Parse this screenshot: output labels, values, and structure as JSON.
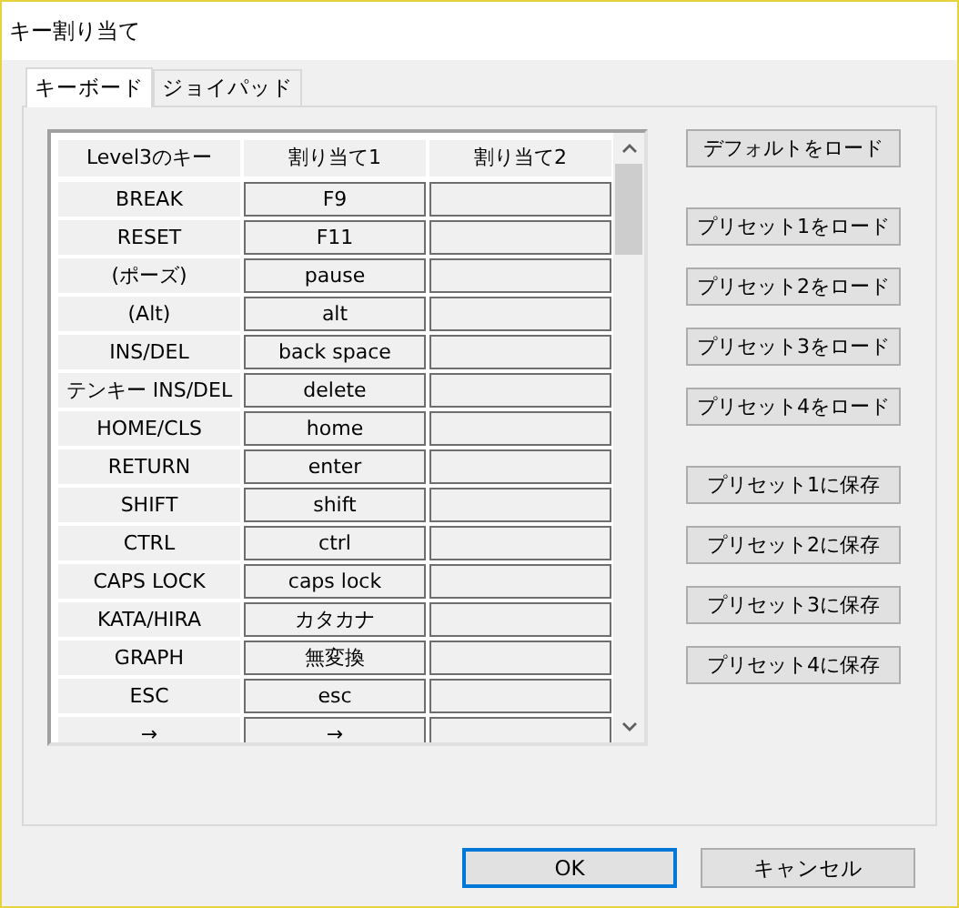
{
  "window": {
    "title": "キー割り当て"
  },
  "tabs": [
    {
      "label": "キーボード",
      "selected": true
    },
    {
      "label": "ジョイパッド",
      "selected": false
    }
  ],
  "table": {
    "columns": [
      "Level3のキー",
      "割り当て1",
      "割り当て2"
    ],
    "rows": [
      {
        "key": "BREAK",
        "assign_1": "F9",
        "assign_2": ""
      },
      {
        "key": "RESET",
        "assign_1": "F11",
        "assign_2": ""
      },
      {
        "key": "(ポーズ)",
        "assign_1": "pause",
        "assign_2": ""
      },
      {
        "key": "(Alt)",
        "assign_1": "alt",
        "assign_2": ""
      },
      {
        "key": "INS/DEL",
        "assign_1": "back space",
        "assign_2": ""
      },
      {
        "key": "テンキー INS/DEL",
        "assign_1": "delete",
        "assign_2": ""
      },
      {
        "key": "HOME/CLS",
        "assign_1": "home",
        "assign_2": ""
      },
      {
        "key": "RETURN",
        "assign_1": "enter",
        "assign_2": ""
      },
      {
        "key": "SHIFT",
        "assign_1": "shift",
        "assign_2": ""
      },
      {
        "key": "CTRL",
        "assign_1": "ctrl",
        "assign_2": ""
      },
      {
        "key": "CAPS LOCK",
        "assign_1": "caps lock",
        "assign_2": ""
      },
      {
        "key": "KATA/HIRA",
        "assign_1": "カタカナ",
        "assign_2": ""
      },
      {
        "key": "GRAPH",
        "assign_1": "無変換",
        "assign_2": ""
      },
      {
        "key": "ESC",
        "assign_1": "esc",
        "assign_2": ""
      },
      {
        "key": "→",
        "assign_1": "→",
        "assign_2": ""
      }
    ]
  },
  "side_button_groups": [
    [
      "デフォルトをロード"
    ],
    [
      "プリセット1をロード",
      "プリセット2をロード",
      "プリセット3をロード",
      "プリセット4をロード"
    ],
    [
      "プリセット1に保存",
      "プリセット2に保存",
      "プリセット3に保存",
      "プリセット4に保存"
    ]
  ],
  "footer_buttons": [
    {
      "label": "OK",
      "focused": true
    },
    {
      "label": "キャンセル",
      "focused": false
    }
  ]
}
